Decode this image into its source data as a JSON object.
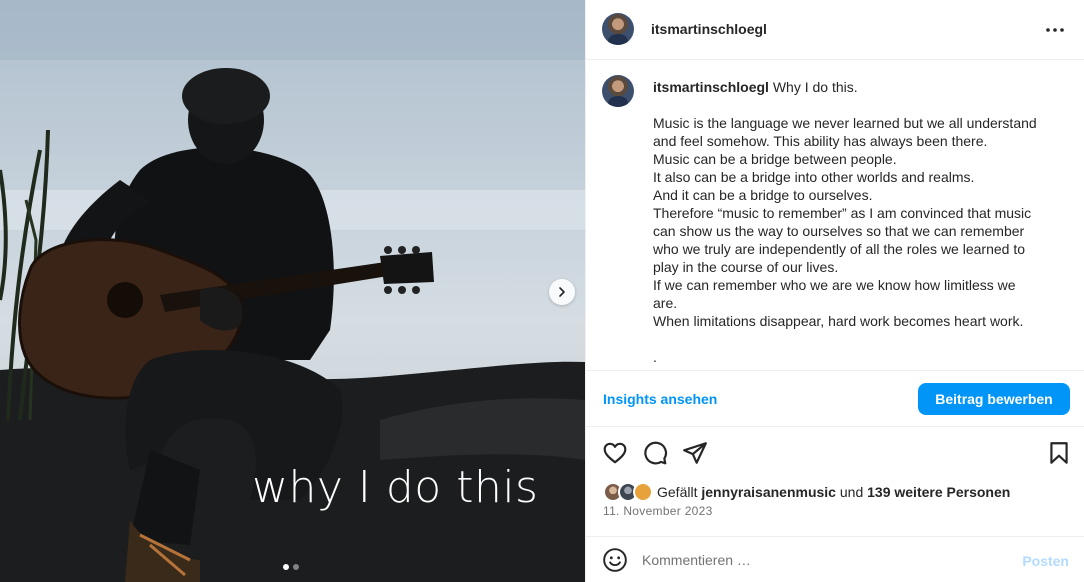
{
  "post": {
    "username": "itsmartinschloegl",
    "overlay_text": "why I do this",
    "carousel": {
      "slides": 2,
      "active_slide": 1
    }
  },
  "caption": {
    "username": "itsmartinschloegl",
    "title": "Why I do this.",
    "body": "Music is the language we never learned but we all understand\nand feel somehow. This ability has always been there.\nMusic can be a bridge between people.\nIt also can be a bridge into other worlds and realms.\nAnd it can be a bridge to ourselves.\nTherefore “music to remember” as I am convinced that music\ncan show us the way to ourselves so that we can remember\nwho we truly are independently of all the roles we learned to\nplay in the course of our lives.\nIf we can remember who we are we know how limitless we\nare.\nWhen limitations disappear, hard work becomes heart work.\n\n."
  },
  "actions": {
    "insights_label": "Insights ansehen",
    "promote_label": "Beitrag bewerben"
  },
  "icons": {
    "like": "heart-icon",
    "comment": "comment-icon",
    "share": "paper-plane-icon",
    "save": "bookmark-icon",
    "more": "more-options-icon",
    "next": "chevron-right-icon",
    "emoji": "emoji-icon"
  },
  "likes": {
    "prefix": "Gefällt",
    "user": "jennyraisanenmusic",
    "conjunction": "und",
    "others": "139 weitere Personen"
  },
  "date": "11. November 2023",
  "comment": {
    "placeholder": "Kommentieren …",
    "post_label": "Posten"
  },
  "colors": {
    "accent": "#0095f6",
    "post_disabled": "#b3dbff",
    "muted_text": "#737373",
    "divider": "#efefef"
  }
}
